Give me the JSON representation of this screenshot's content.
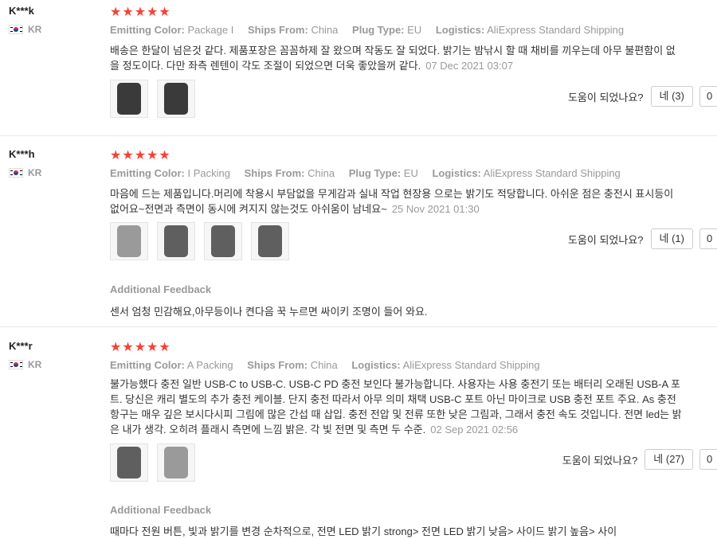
{
  "reviews": [
    {
      "user": "K***k",
      "country": "KR",
      "stars": "★★★★★",
      "attrs": [
        {
          "label": "Emitting Color:",
          "value": "Package I"
        },
        {
          "label": "Ships From:",
          "value": "China"
        },
        {
          "label": "Plug Type:",
          "value": "EU"
        },
        {
          "label": "Logistics:",
          "value": "AliExpress Standard Shipping"
        }
      ],
      "text": "배송은 한달이 넘은것 같다. 제품포장은 꼼꼼하제 잘 왔으며 작동도 잘 되었다. 밝기는 밤낚시 할 때 채비를 끼우는데 아무 불편함이 없을 정도이다. 다만 좌측 렌텐이 각도 조절이 되었으면 더욱 좋았을꺼 같다.",
      "date": "07 Dec 2021 03:07",
      "helpful_q": "도움이 되었나요?",
      "yes_label": "네 (3)",
      "no_label": "0"
    },
    {
      "user": "K***h",
      "country": "KR",
      "stars": "★★★★★",
      "attrs": [
        {
          "label": "Emitting Color:",
          "value": "I Packing"
        },
        {
          "label": "Ships From:",
          "value": "China"
        },
        {
          "label": "Plug Type:",
          "value": "EU"
        },
        {
          "label": "Logistics:",
          "value": "AliExpress Standard Shipping"
        }
      ],
      "text": "마음에 드는 제품입니다.머리에 착용시 부담없을 무게감과 실내 작업 현장용 으로는 밝기도 적당합니다. 아쉬운 점은 충전시 표시등이 없어요~전면과 측면이 동시에 켜지지 않는것도 아쉬움이 남네요~",
      "date": "25 Nov 2021 01:30",
      "helpful_q": "도움이 되었나요?",
      "yes_label": "네 (1)",
      "no_label": "0",
      "additional_title": "Additional Feedback",
      "additional_text": "센서 엄청 민감해요,아무등이나 켠다음 꾹 누르면 싸이키 조명이 들어 와요."
    },
    {
      "user": "K***r",
      "country": "KR",
      "stars": "★★★★★",
      "attrs": [
        {
          "label": "Emitting Color:",
          "value": "A Packing"
        },
        {
          "label": "Ships From:",
          "value": "China"
        },
        {
          "label": "Logistics:",
          "value": "AliExpress Standard Shipping"
        }
      ],
      "text": "불가능했다 충전 일반 USB-C to USB-C. USB-C PD 충전 보인다 불가능합니다. 사용자는 사용 충전기 또는 배터리 오래된 USB-A 포트. 당신은 캐리 별도의 추가 충전 케이블. 단지 충전 따라서 아무 의미 채택 USB-C 포트 아닌 마이크로 USB 충전 포트 주요. As 충전 항구는 매우 깊은 보시다시피 그림에 많은 간섭 때 삽입. 충전 전압 및 전류 또한 낮은 그림과, 그래서 충전 속도 것입니다. 전면 led는 밝은 내가 생각. 오히려 플래시 측면에 느낌 밝은. 각 빛 전면 및 측면 두 수준.",
      "date": "02 Sep 2021 02:56",
      "helpful_q": "도움이 되었나요?",
      "yes_label": "네 (27)",
      "no_label": "0",
      "additional_title": "Additional Feedback",
      "additional_text": "때마다 전원 버튼, 빛과 밝기를 변경 순차적으로, 전면 LED 밝기 strong> 전면 LED 밝기 낮음> 사이드 밝기 높음> 사이"
    }
  ],
  "icons": {
    "flag": "korea-flag-icon",
    "thumb": "review-photo-thumbnail"
  }
}
